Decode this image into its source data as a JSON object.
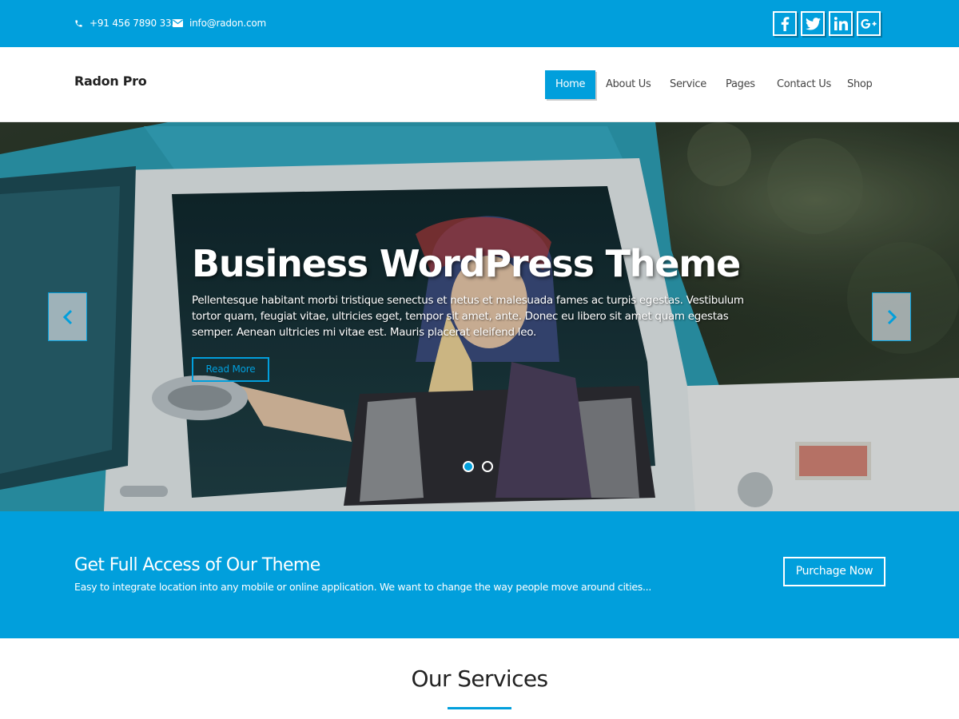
{
  "topbar": {
    "phone": "+91 456 7890 333",
    "email": "info@radon.com",
    "social": [
      "facebook-icon",
      "twitter-icon",
      "linkedin-icon",
      "google-plus-icon"
    ]
  },
  "header": {
    "site_title": "Radon Pro",
    "nav": [
      {
        "label": "Home"
      },
      {
        "label": "About Us"
      },
      {
        "label": "Service"
      },
      {
        "label": "Pages"
      },
      {
        "label": "Contact Us"
      },
      {
        "label": "Shop"
      }
    ]
  },
  "hero": {
    "title": "Business WordPress Theme",
    "text": "Pellentesque habitant morbi tristique senectus et netus et malesuada fames ac turpis egestas. Vestibulum tortor quam, feugiat vitae, ultricies eget, tempor sit amet, ante. Donec eu libero sit amet quam egestas semper. Aenean ultricies mi vitae est. Mauris placerat eleifend leo.",
    "button": "Read More",
    "slides": 2,
    "active_slide": 1
  },
  "cta": {
    "title": "Get Full Access of Our Theme",
    "text": "Easy to integrate location into any mobile or online application. We want to change the way people move around cities...",
    "button": "Purchage Now"
  },
  "services": {
    "title": "Our Services"
  },
  "colors": {
    "accent": "#019fdc",
    "white": "#ffffff"
  }
}
